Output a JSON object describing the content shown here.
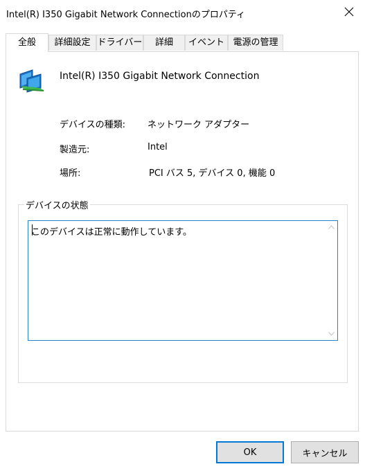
{
  "window": {
    "title": "Intel(R) I350 Gigabit Network Connectionのプロパティ"
  },
  "tabs": [
    "全般",
    "詳細設定",
    "ドライバー",
    "詳細",
    "イベント",
    "電源の管理"
  ],
  "device": {
    "name": "Intel(R) I350 Gigabit Network Connection",
    "icon": "network-adapter-icon",
    "properties": [
      {
        "label": "デバイスの種類:",
        "value": "ネットワーク アダプター"
      },
      {
        "label": "製造元:",
        "value": "Intel"
      },
      {
        "label": "場所:",
        "value": "PCI バス 5, デバイス 0, 機能 0"
      }
    ]
  },
  "status_group": {
    "legend": "デバイスの状態",
    "text": "このデバイスは正常に動作しています。"
  },
  "buttons": {
    "ok": "OK",
    "cancel": "キャンセル"
  },
  "colors": {
    "focus_border": "#2b7fc9",
    "default_button_border": "#0078d7",
    "button_face": "#e1e1e1"
  }
}
